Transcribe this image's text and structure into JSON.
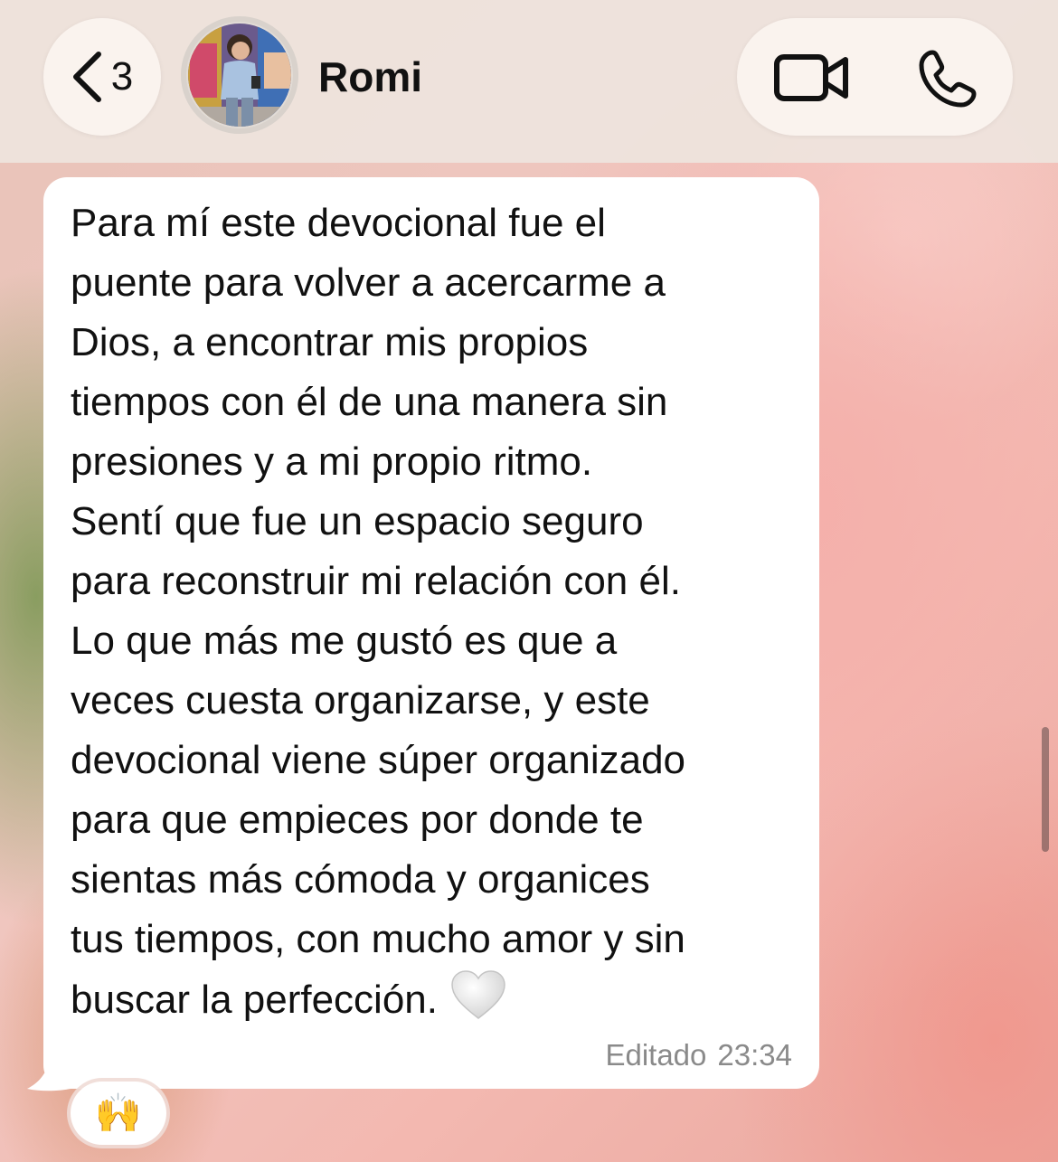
{
  "header": {
    "back_count": "3",
    "contact_name": "Romi",
    "icons": {
      "back": "chevron-left-icon",
      "video": "video-camera-icon",
      "phone": "phone-icon"
    }
  },
  "message": {
    "text": "Para mí este devocional fue el\npuente para volver a acercarme a\nDios, a encontrar mis propios\ntiempos con él de una manera sin\npresiones y a mi propio ritmo.\nSentí que fue un espacio seguro\npara reconstruir mi relación con él.\nLo que más me gustó es que a\nveces cuesta organizarse, y este\ndevocional viene súper organizado\npara que empieces por donde te\nsientas más cómoda y organices\ntus tiempos, con mucho amor y sin\nbuscar la perfección.",
    "trailing_emoji": "white-heart-icon",
    "edited_label": "Editado",
    "time": "23:34",
    "reaction": "🙌"
  },
  "colors": {
    "bubble": "#ffffff",
    "header_bg": "#eee4de",
    "meta_text": "#8a8a8a"
  }
}
